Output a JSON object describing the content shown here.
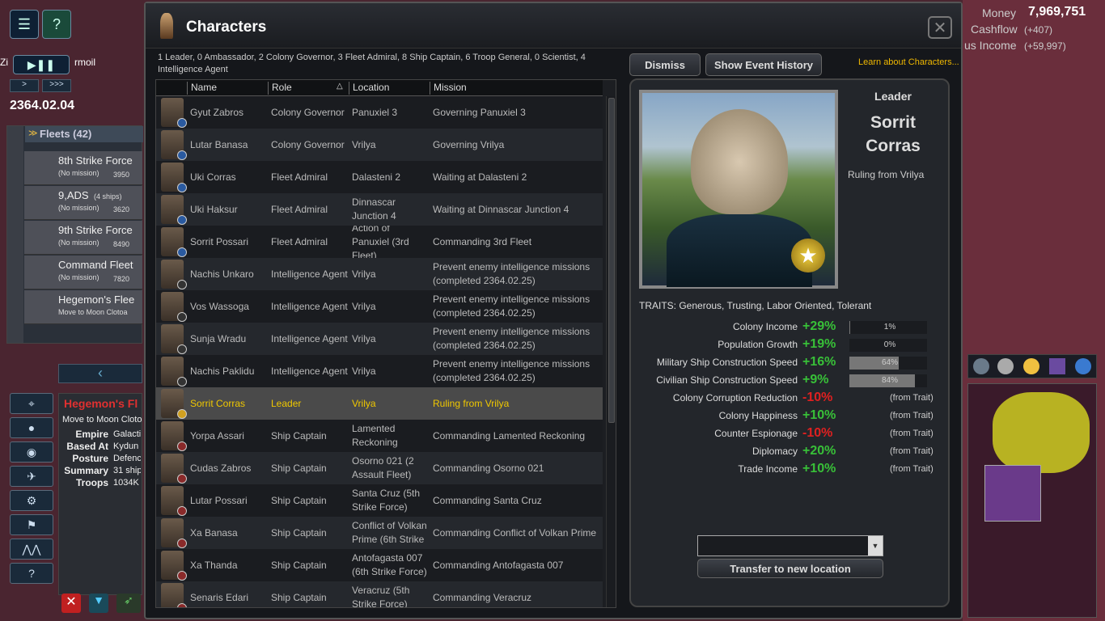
{
  "game": {
    "date": "2364.02.04",
    "money_label": "Money",
    "money_value": "7,969,751",
    "cashflow_label": "Cashflow",
    "cashflow_value": "(+407)",
    "income_label": "us Income",
    "income_value": "(+59,997)",
    "speed_prev": ">",
    "speed_next": ">>>",
    "empire_fragment": "Zi",
    "turmoil_fragment": "rmoil",
    "fleets_header": "Fleets (42)",
    "fleets": [
      {
        "name": "8th Strike Force",
        "mission": "(No mission)",
        "value": "3950"
      },
      {
        "name": "9,ADS",
        "ships": "(4 ships)",
        "mission": "(No mission)",
        "value": "3620"
      },
      {
        "name": "9th Strike Force",
        "mission": "(No mission)",
        "value": "8490"
      },
      {
        "name": "Command Fleet",
        "mission": "(No mission)",
        "value": "7820"
      },
      {
        "name": "Hegemon's Flee",
        "mission": "Move to Moon Clotoa",
        "value": ""
      }
    ],
    "selected_fleet": {
      "title": "Hegemon's Fl",
      "subtitle": "Move to Moon Cloto",
      "rows": [
        {
          "label": "Empire",
          "value": "Galacti"
        },
        {
          "label": "Based At",
          "value": "Kydun"
        },
        {
          "label": "Posture",
          "value": "Defenc"
        },
        {
          "label": "Summary",
          "value": "31 ship"
        },
        {
          "label": "Troops",
          "value": "1034K"
        }
      ]
    }
  },
  "dialog": {
    "title": "Characters",
    "close_glyph": "✕",
    "summary": "1 Leader, 0 Ambassador, 2 Colony Governor, 3 Fleet Admiral, 8 Ship Captain, 6 Troop General, 0 Scientist, 4 Intelligence Agent",
    "dismiss_label": "Dismiss",
    "history_label": "Show Event History",
    "learn_label": "Learn about Characters...",
    "columns": {
      "name": "Name",
      "role": "Role",
      "sort": "△",
      "location": "Location",
      "mission": "Mission"
    },
    "rows": [
      {
        "name": "Gyut Zabros",
        "role": "Colony Governor",
        "location": "Panuxiel 3",
        "mission": "Governing Panuxiel 3",
        "badge": ""
      },
      {
        "name": "Lutar Banasa",
        "role": "Colony Governor",
        "location": "Vrilya",
        "mission": "Governing Vrilya",
        "badge": ""
      },
      {
        "name": "Uki Corras",
        "role": "Fleet Admiral",
        "location": "Dalasteni 2",
        "mission": "Waiting at Dalasteni 2",
        "badge": ""
      },
      {
        "name": "Uki Haksur",
        "role": "Fleet Admiral",
        "location": "Dinnascar Junction 4",
        "mission": "Waiting at Dinnascar Junction 4",
        "badge": ""
      },
      {
        "name": "Sorrit Possari",
        "role": "Fleet Admiral",
        "location": "Action of Panuxiel (3rd Fleet)",
        "mission": "Commanding 3rd Fleet",
        "badge": ""
      },
      {
        "name": "Nachis Unkaro",
        "role": "Intelligence Agent",
        "location": "Vrilya",
        "mission": "Prevent enemy intelligence missions (completed 2364.02.25)",
        "badge": "dark"
      },
      {
        "name": "Vos Wassoga",
        "role": "Intelligence Agent",
        "location": "Vrilya",
        "mission": "Prevent enemy intelligence missions (completed 2364.02.25)",
        "badge": "dark"
      },
      {
        "name": "Sunja Wradu",
        "role": "Intelligence Agent",
        "location": "Vrilya",
        "mission": "Prevent enemy intelligence missions (completed 2364.02.25)",
        "badge": "dark"
      },
      {
        "name": "Nachis Paklidu",
        "role": "Intelligence Agent",
        "location": "Vrilya",
        "mission": "Prevent enemy intelligence missions (completed 2364.02.25)",
        "badge": "dark"
      },
      {
        "name": "Sorrit Corras",
        "role": "Leader",
        "location": "Vrilya",
        "mission": "Ruling from Vrilya",
        "badge": "star"
      },
      {
        "name": "Yorpa Assari",
        "role": "Ship Captain",
        "location": "Lamented Reckoning",
        "mission": "Commanding Lamented Reckoning",
        "badge": "red"
      },
      {
        "name": "Cudas Zabros",
        "role": "Ship Captain",
        "location": "Osorno 021 (2 Assault Fleet)",
        "mission": "Commanding Osorno 021",
        "badge": "red"
      },
      {
        "name": "Lutar Possari",
        "role": "Ship Captain",
        "location": "Santa Cruz (5th Strike Force)",
        "mission": "Commanding Santa Cruz",
        "badge": "red"
      },
      {
        "name": "Xa Banasa",
        "role": "Ship Captain",
        "location": "Conflict of Volkan Prime (6th Strike",
        "mission": "Commanding Conflict of Volkan Prime",
        "badge": "red"
      },
      {
        "name": "Xa Thanda",
        "role": "Ship Captain",
        "location": "Antofagasta 007 (6th Strike Force)",
        "mission": "Commanding Antofagasta 007",
        "badge": "red"
      },
      {
        "name": "Senaris Edari",
        "role": "Ship Captain",
        "location": "Veracruz (5th Strike Force)",
        "mission": "Commanding Veracruz",
        "badge": "red"
      }
    ],
    "selected_index": 9,
    "detail": {
      "role": "Leader",
      "name_line1": "Sorrit",
      "name_line2": "Corras",
      "mission": "Ruling from Vrilya",
      "traits": "TRAITS: Generous, Trusting, Labor Oriented, Tolerant",
      "bonuses": [
        {
          "label": "Colony Income",
          "value": "+29%",
          "sign": "pos",
          "bar_text": "1%",
          "bar_fraction": 0.01,
          "note": ""
        },
        {
          "label": "Population Growth",
          "value": "+19%",
          "sign": "pos",
          "bar_text": "0%",
          "bar_fraction": 0.0,
          "note": ""
        },
        {
          "label": "Military Ship Construction Speed",
          "value": "+16%",
          "sign": "pos",
          "bar_text": "64%",
          "bar_fraction": 0.64,
          "note": ""
        },
        {
          "label": "Civilian Ship Construction Speed",
          "value": "+9%",
          "sign": "pos",
          "bar_text": "84%",
          "bar_fraction": 0.84,
          "note": ""
        },
        {
          "label": "Colony Corruption Reduction",
          "value": "-10%",
          "sign": "neg",
          "bar_text": "",
          "bar_fraction": null,
          "note": "(from Trait)"
        },
        {
          "label": "Colony Happiness",
          "value": "+10%",
          "sign": "pos",
          "bar_text": "",
          "bar_fraction": null,
          "note": "(from Trait)"
        },
        {
          "label": "Counter Espionage",
          "value": "-10%",
          "sign": "neg",
          "bar_text": "",
          "bar_fraction": null,
          "note": "(from Trait)"
        },
        {
          "label": "Diplomacy",
          "value": "+20%",
          "sign": "pos",
          "bar_text": "",
          "bar_fraction": null,
          "note": "(from Trait)"
        },
        {
          "label": "Trade Income",
          "value": "+10%",
          "sign": "pos",
          "bar_text": "",
          "bar_fraction": null,
          "note": "(from Trait)"
        }
      ],
      "location_select_value": "",
      "transfer_label": "Transfer to new location"
    }
  }
}
